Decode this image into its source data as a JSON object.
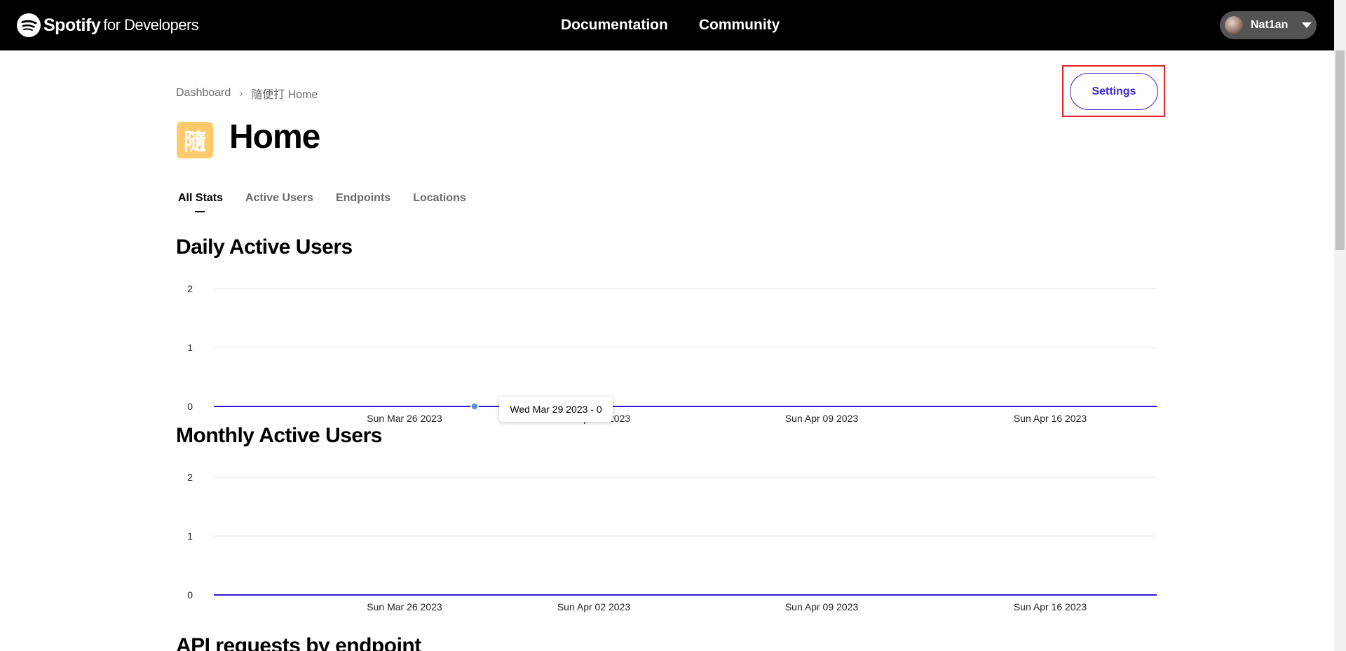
{
  "nav": {
    "brand": "Spotify",
    "brand_sub": "for Developers",
    "links": [
      "Documentation",
      "Community"
    ],
    "user_name": "Nat1an"
  },
  "breadcrumb": {
    "items": [
      "Dashboard",
      "隨便打 Home"
    ],
    "separator": "›"
  },
  "settings_label": "Settings",
  "app": {
    "icon_char": "隨",
    "icon_color": "#ffca6b",
    "title": "Home"
  },
  "tabs": [
    "All Stats",
    "Active Users",
    "Endpoints",
    "Locations"
  ],
  "sections": {
    "daily": "Daily Active Users",
    "monthly": "Monthly Active Users",
    "api": "API requests by endpoint"
  },
  "tooltip": "Wed Mar 29 2023 - 0",
  "colors": {
    "line": "#2d1bd6",
    "accent": "#3b28cc",
    "highlight": "#e0202a"
  },
  "chart_data": [
    {
      "type": "line",
      "title": "Daily Active Users",
      "x_ticks": [
        "Sun Mar 26 2023",
        "Sun Apr 02 2023",
        "Sun Apr 09 2023",
        "Sun Apr 16 2023"
      ],
      "y_ticks": [
        0,
        1,
        2
      ],
      "ylim": [
        0,
        2
      ],
      "series": [
        {
          "values": [
            0,
            0
          ]
        }
      ],
      "grid": true
    },
    {
      "type": "line",
      "title": "Monthly Active Users",
      "x_ticks": [
        "Sun Mar 26 2023",
        "Sun Apr 02 2023",
        "Sun Apr 09 2023",
        "Sun Apr 16 2023"
      ],
      "y_ticks": [
        0,
        1,
        2
      ],
      "ylim": [
        0,
        2
      ],
      "series": [
        {
          "values": [
            0,
            0
          ]
        }
      ],
      "grid": true
    }
  ]
}
